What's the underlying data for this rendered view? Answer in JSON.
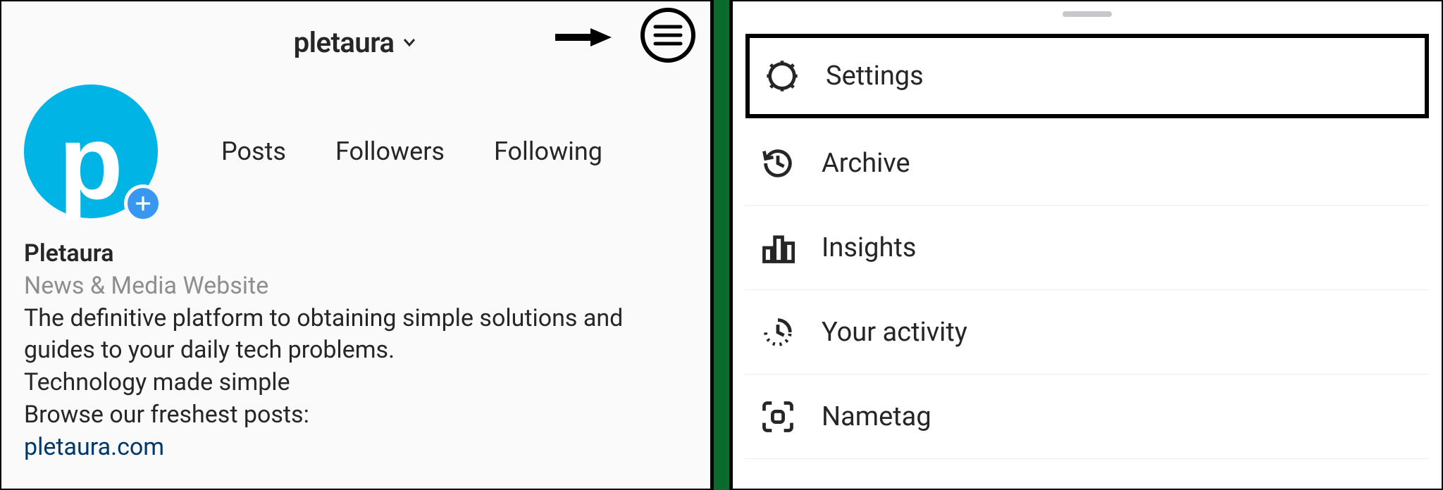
{
  "profile": {
    "username": "pletaura",
    "avatar_letter": "p",
    "stats": {
      "posts_label": "Posts",
      "followers_label": "Followers",
      "following_label": "Following"
    },
    "display_name": "Pletaura",
    "category": "News & Media Website",
    "bio_line1": "The definitive platform to obtaining simple solutions and guides to your daily tech problems.",
    "bio_line2": "Technology made simple",
    "bio_line3": "Browse our freshest posts:",
    "link": "pletaura.com"
  },
  "menu": {
    "items": [
      {
        "label": "Settings",
        "icon": "gear",
        "highlight": true
      },
      {
        "label": "Archive",
        "icon": "history",
        "highlight": false
      },
      {
        "label": "Insights",
        "icon": "bars",
        "highlight": false
      },
      {
        "label": "Your activity",
        "icon": "activity",
        "highlight": false
      },
      {
        "label": "Nametag",
        "icon": "scan",
        "highlight": false
      }
    ]
  }
}
